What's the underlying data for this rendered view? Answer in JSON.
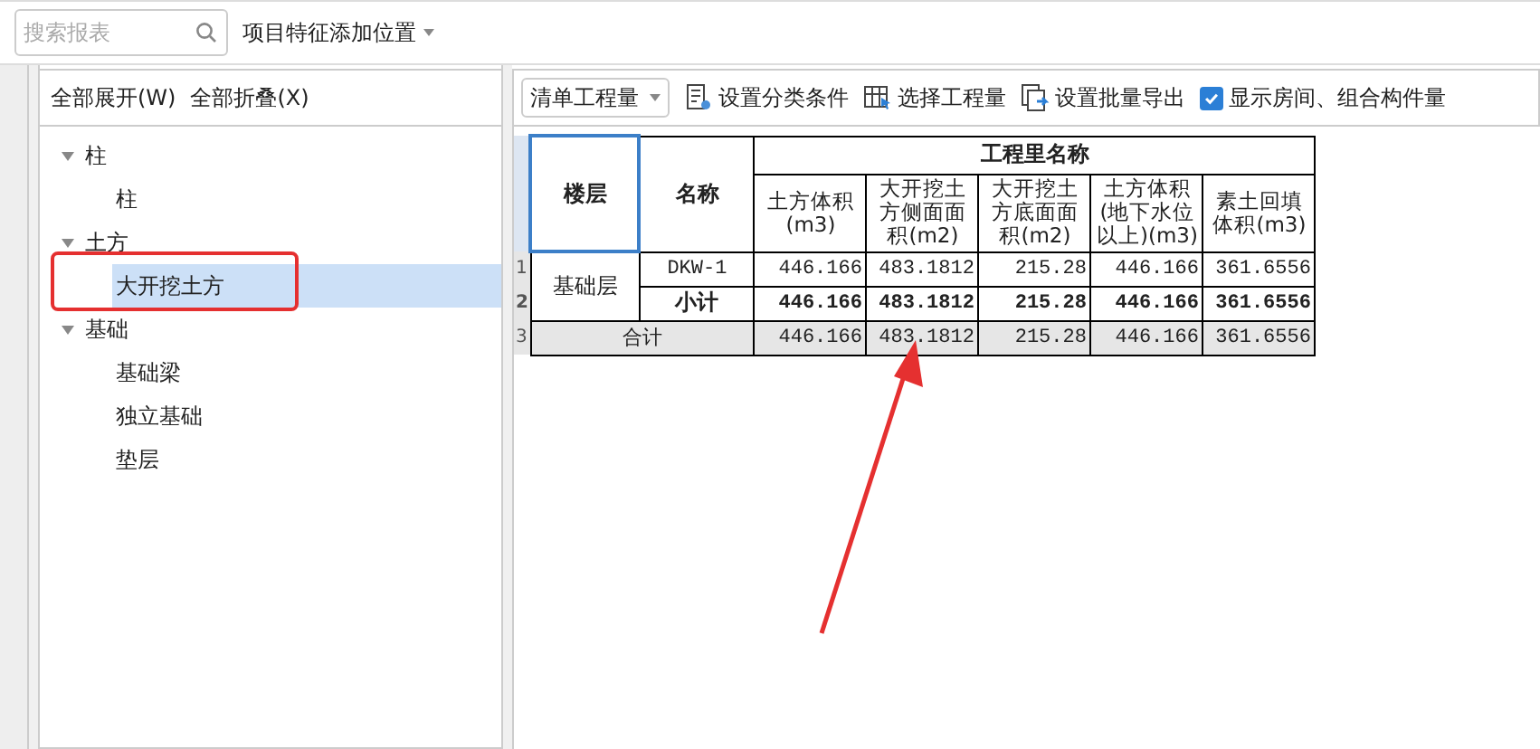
{
  "top_bar": {
    "search": {
      "placeholder": "搜索报表"
    },
    "position_dropdown": "项目特征添加位置"
  },
  "left_panel": {
    "buttons": [
      "全部展开(W)",
      "全部折叠(X)"
    ],
    "tree": [
      {
        "label": "柱",
        "expanded": true,
        "selected": false,
        "children": [
          {
            "label": "柱",
            "selected": false
          }
        ]
      },
      {
        "label": "土方",
        "expanded": true,
        "selected": false,
        "children": [
          {
            "label": "大开挖土方",
            "selected": true
          }
        ]
      },
      {
        "label": "基础",
        "expanded": true,
        "selected": false,
        "children": [
          {
            "label": "基础梁",
            "selected": false
          },
          {
            "label": "独立基础",
            "selected": false
          },
          {
            "label": "垫层",
            "selected": false
          }
        ]
      }
    ]
  },
  "toolbar": {
    "quantity_dropdown": "清单工程量",
    "actions": [
      {
        "kind": "conditions",
        "label": "设置分类条件"
      },
      {
        "kind": "select",
        "label": "选择工程量"
      },
      {
        "kind": "export",
        "label": "设置批量导出"
      }
    ],
    "show_rooms": {
      "label": "显示房间、组合构件量",
      "checked": true
    }
  },
  "table": {
    "floor_header": "楼层",
    "name_header": "名称",
    "group_header": "工程里名称",
    "columns": [
      "土方体积(m3)",
      "大开挖土方侧面面积(m2)",
      "大开挖土方底面面积(m2)",
      "土方体积(地下水位以上)(m3)",
      "素土回填体积(m3)"
    ],
    "rows": [
      {
        "kind": "item",
        "row_number": "1",
        "floor": "基础层",
        "name": "DKW-1",
        "values": [
          "446.166",
          "483.1812",
          "215.28",
          "446.166",
          "361.6556"
        ]
      },
      {
        "kind": "subtotal",
        "row_number": "2",
        "name": "小计",
        "values": [
          "446.166",
          "483.1812",
          "215.28",
          "446.166",
          "361.6556"
        ]
      },
      {
        "kind": "total",
        "row_number": "3",
        "name": "合计",
        "values": [
          "446.166",
          "483.1812",
          "215.28",
          "446.166",
          "361.6556"
        ]
      }
    ]
  }
}
